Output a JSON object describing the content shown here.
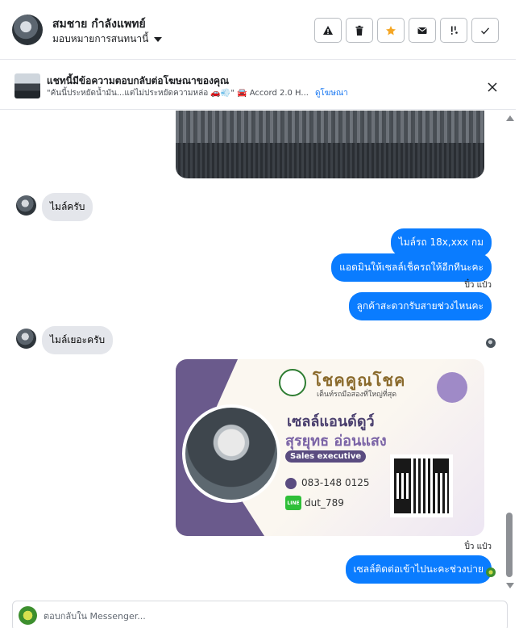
{
  "header": {
    "contact_name": "สมชาย กำลังแพทย์",
    "assign_label": "มอบหมายการสนทนานี้",
    "actions": [
      {
        "name": "spam-button",
        "icon": "warning-icon"
      },
      {
        "name": "delete-button",
        "icon": "trash-icon"
      },
      {
        "name": "star-button",
        "icon": "star-icon",
        "color": "#f5a623"
      },
      {
        "name": "unread-button",
        "icon": "envelope-icon"
      },
      {
        "name": "follow-up-button",
        "icon": "follow-up-icon"
      },
      {
        "name": "done-button",
        "icon": "checkmark-icon"
      }
    ]
  },
  "ad_bar": {
    "title": "แชทนี้มีข้อความตอบกลับต่อโฆษณาของคุณ",
    "snippet": "\"คันนี้ประหยัดน้ำมัน...แต่ไม่ประหยัดความหล่อ 🚗💨\" 🚘 Accord 2.0 H...",
    "link": "ดูโฆษณา"
  },
  "messages": {
    "in_1": "ไมล์ครับ",
    "out_1": "ไมล์รถ 18x,xxx  กม",
    "out_2": "แอดมินให้เซลล์เช็ครถให้อีกทีนะคะ",
    "sender_1": "ปิ๋ว แป๋ว",
    "out_3": "ลูกค้าสะดวกรับสายช่วงไหนคะ",
    "in_2": "ไมล์เยอะครับ",
    "sender_2": "ปิ๋ว แป๋ว",
    "out_4": "เซลล์ติดต่อเข้าไปนะคะช่วงบ่าย"
  },
  "card": {
    "brand": "โชคคูณโชค",
    "slogan": "เต็นท์รถมือสองที่ใหญ่ที่สุด",
    "name_line1": "เซลล์แอนด์ดูว์",
    "name_line2": "สุรยุทธ อ่อนแสง",
    "role": "Sales executive",
    "phone": "083-148 0125",
    "line_label": "LINE",
    "line_id": "dut_789"
  },
  "composer": {
    "placeholder": "ตอบกลับใน Messenger..."
  },
  "colors": {
    "outgoing_bubble": "#0a7cff",
    "incoming_bubble": "#e4e6eb",
    "link": "#1877f2"
  }
}
